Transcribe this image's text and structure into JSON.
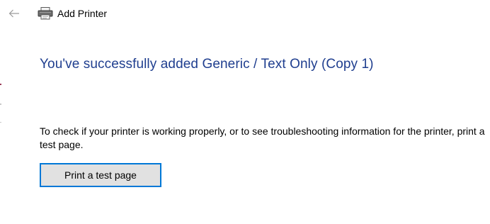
{
  "window": {
    "title": "Add Printer",
    "back_icon": "back-arrow-icon",
    "title_icon": "printer-icon"
  },
  "main": {
    "heading": "You've successfully added Generic / Text Only (Copy 1)",
    "info_text": "To check if your printer is working properly, or to see troubleshooting information for the printer, print a test page.",
    "test_button_label": "Print a test page"
  },
  "colors": {
    "heading": "#1f3e8f",
    "button_border": "#0078d7",
    "button_background": "#e1e1e1"
  }
}
